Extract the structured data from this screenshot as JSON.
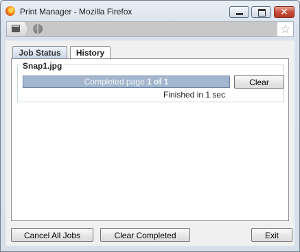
{
  "window": {
    "title": "Print Manager - Mozilla Firefox"
  },
  "tabs": [
    {
      "label": "Job Status"
    },
    {
      "label": "History"
    }
  ],
  "job": {
    "name": "Snap1.jpg",
    "progress_prefix": "Completed page ",
    "current_page": "1",
    "of_text": " of ",
    "total_pages": "1",
    "progress_fraction": 1,
    "clear_label": "Clear",
    "finished_text": "Finished in 1 sec"
  },
  "footer": {
    "cancel_all_label": "Cancel All Jobs",
    "clear_completed_label": "Clear Completed",
    "exit_label": "Exit"
  },
  "colors": {
    "progress_fill": "#a3b6cd",
    "close_button": "#c7503d"
  }
}
